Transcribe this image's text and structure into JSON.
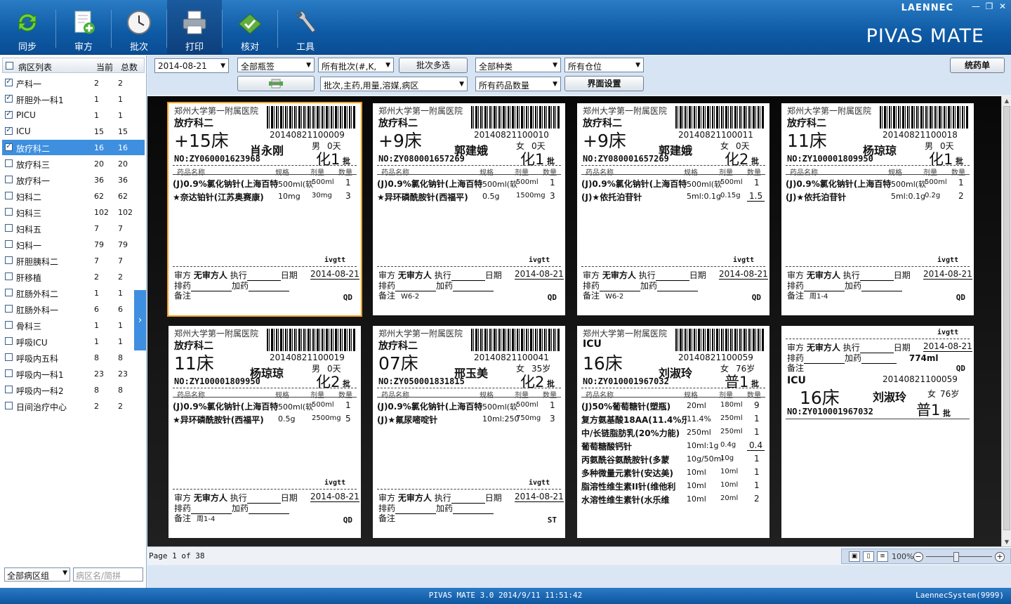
{
  "app": {
    "brand_top": "LAENNEC",
    "brand_big": "PIVAS MATE",
    "win_min": "—",
    "win_restore": "❐",
    "win_close": "✕"
  },
  "toolbar": [
    {
      "key": "sync",
      "label": "同步",
      "icon": "sync-icon"
    },
    {
      "key": "review",
      "label": "审方",
      "icon": "prescription-review-icon"
    },
    {
      "key": "batch",
      "label": "批次",
      "icon": "clock-icon"
    },
    {
      "key": "print",
      "label": "打印",
      "icon": "printer-icon"
    },
    {
      "key": "check",
      "label": "核对",
      "icon": "verify-icon"
    },
    {
      "key": "tools",
      "label": "工具",
      "icon": "wrench-icon"
    }
  ],
  "sidebar": {
    "header": {
      "name": "病区列表",
      "current": "当前",
      "total": "总数"
    },
    "wards": [
      {
        "name": "产科一",
        "current": "2",
        "total": "2",
        "checked": true
      },
      {
        "name": "肝胆外一科1",
        "current": "1",
        "total": "1",
        "checked": true
      },
      {
        "name": "PICU",
        "current": "1",
        "total": "1",
        "checked": true
      },
      {
        "name": "ICU",
        "current": "15",
        "total": "15",
        "checked": true
      },
      {
        "name": "放疗科二",
        "current": "16",
        "total": "16",
        "checked": true,
        "selected": true
      },
      {
        "name": "放疗科三",
        "current": "20",
        "total": "20",
        "checked": false
      },
      {
        "name": "放疗科一",
        "current": "36",
        "total": "36",
        "checked": false
      },
      {
        "name": "妇科二",
        "current": "62",
        "total": "62",
        "checked": false
      },
      {
        "name": "妇科三",
        "current": "102",
        "total": "102",
        "checked": false
      },
      {
        "name": "妇科五",
        "current": "7",
        "total": "7",
        "checked": false
      },
      {
        "name": "妇科一",
        "current": "79",
        "total": "79",
        "checked": false
      },
      {
        "name": "肝胆胰科二",
        "current": "7",
        "total": "7",
        "checked": false
      },
      {
        "name": "肝移植",
        "current": "2",
        "total": "2",
        "checked": false
      },
      {
        "name": "肛肠外科二",
        "current": "1",
        "total": "1",
        "checked": false
      },
      {
        "name": "肛肠外科一",
        "current": "6",
        "total": "6",
        "checked": false
      },
      {
        "name": "骨科三",
        "current": "1",
        "total": "1",
        "checked": false
      },
      {
        "name": "呼吸ICU",
        "current": "1",
        "total": "1",
        "checked": false
      },
      {
        "name": "呼吸内五科",
        "current": "8",
        "total": "8",
        "checked": false
      },
      {
        "name": "呼吸内一科1",
        "current": "23",
        "total": "23",
        "checked": false
      },
      {
        "name": "呼吸内一科2",
        "current": "8",
        "total": "8",
        "checked": false
      },
      {
        "name": "日间治疗中心",
        "current": "2",
        "total": "2",
        "checked": false
      }
    ],
    "ward_group": "全部病区组",
    "search_placeholder": "病区名/简拼"
  },
  "filters": {
    "date": "2014-08-21",
    "label_type": "全部瓶签",
    "batch": "所有批次(#,K,",
    "batch_multi": "批次多选",
    "category": "全部种类",
    "position": "所有仓位",
    "sort": "批次,主药,用量,溶媒,病区",
    "quantity": "所有药品数量",
    "ui_settings": "界面设置",
    "summary": "统药单"
  },
  "labels": [
    {
      "hospital": "郑州大学第一附属医院",
      "ward": "放疗科二",
      "bed": "+15床",
      "batch_no": "20140821100009",
      "patient": "肖永刚",
      "sex": "男",
      "age": "0天",
      "no": "NO:ZY060001623968",
      "type": "化1",
      "pi": "批",
      "drugs": [
        {
          "name": "(J)0.9%氯化钠针(上海百特)",
          "spec": "500ml(软",
          "dose": "500ml",
          "qty": "1"
        },
        {
          "name": "★奈达铂针(江苏奥赛康)",
          "spec": "10mg",
          "dose": "30mg",
          "qty": "3"
        }
      ],
      "route": "ivgtt",
      "reviewer": "无审方人",
      "date": "2014-08-21",
      "remark": "",
      "freq": "QD",
      "active": true
    },
    {
      "hospital": "郑州大学第一附属医院",
      "ward": "放疗科二",
      "bed": "+9床",
      "batch_no": "20140821100010",
      "patient": "郭建娥",
      "sex": "女",
      "age": "0天",
      "no": "NO:ZY080001657269",
      "type": "化1",
      "pi": "批",
      "drugs": [
        {
          "name": "(J)0.9%氯化钠针(上海百特)",
          "spec": "500ml(软",
          "dose": "500ml",
          "qty": "1"
        },
        {
          "name": "★异环磷酰胺针(西福平)",
          "spec": "0.5g",
          "dose": "1500mg",
          "qty": "3"
        }
      ],
      "route": "ivgtt",
      "reviewer": "无审方人",
      "date": "2014-08-21",
      "remark": "W6-2",
      "freq": "QD"
    },
    {
      "hospital": "郑州大学第一附属医院",
      "ward": "放疗科二",
      "bed": "+9床",
      "batch_no": "20140821100011",
      "patient": "郭建娥",
      "sex": "女",
      "age": "0天",
      "no": "NO:ZY080001657269",
      "type": "化2",
      "pi": "批",
      "drugs": [
        {
          "name": "(J)0.9%氯化钠针(上海百特)",
          "spec": "500ml(软",
          "dose": "500ml",
          "qty": "1"
        },
        {
          "name": "(J)★依托泊苷针",
          "spec": "5ml:0.1g",
          "dose": "0.15g",
          "qty": "1.5",
          "ul": true
        }
      ],
      "route": "ivgtt",
      "reviewer": "无审方人",
      "date": "2014-08-21",
      "remark": "W6-2",
      "freq": "QD"
    },
    {
      "hospital": "郑州大学第一附属医院",
      "ward": "放疗科二",
      "bed": "11床",
      "batch_no": "20140821100018",
      "patient": "杨琼琼",
      "sex": "男",
      "age": "0天",
      "no": "NO:ZY100001809950",
      "type": "化1",
      "pi": "批",
      "drugs": [
        {
          "name": "(J)0.9%氯化钠针(上海百特)",
          "spec": "500ml(软",
          "dose": "500ml",
          "qty": "1"
        },
        {
          "name": "(J)★依托泊苷针",
          "spec": "5ml:0.1g",
          "dose": "0.2g",
          "qty": "2"
        }
      ],
      "route": "ivgtt",
      "reviewer": "无审方人",
      "date": "2014-08-21",
      "remark": "周1-4",
      "freq": "QD"
    },
    {
      "hospital": "郑州大学第一附属医院",
      "ward": "放疗科二",
      "bed": "11床",
      "batch_no": "20140821100019",
      "patient": "杨琼琼",
      "sex": "男",
      "age": "0天",
      "no": "NO:ZY100001809950",
      "type": "化2",
      "pi": "批",
      "drugs": [
        {
          "name": "(J)0.9%氯化钠针(上海百特)",
          "spec": "500ml(软",
          "dose": "500ml",
          "qty": "1"
        },
        {
          "name": "★异环磷酰胺针(西福平)",
          "spec": "0.5g",
          "dose": "2500mg",
          "qty": "5"
        }
      ],
      "route": "ivgtt",
      "reviewer": "无审方人",
      "date": "2014-08-21",
      "remark": "周1-4",
      "freq": "QD"
    },
    {
      "hospital": "郑州大学第一附属医院",
      "ward": "放疗科二",
      "bed": "07床",
      "batch_no": "20140821100041",
      "patient": "邢玉美",
      "sex": "女",
      "age": "35岁",
      "no": "NO:ZY050001831815",
      "type": "化2",
      "pi": "批",
      "drugs": [
        {
          "name": "(J)0.9%氯化钠针(上海百特)",
          "spec": "500ml(软",
          "dose": "500ml",
          "qty": "1"
        },
        {
          "name": "(J)★氟尿嘧啶针",
          "spec": "10ml:250",
          "dose": "750mg",
          "qty": "3"
        }
      ],
      "route": "ivgtt",
      "reviewer": "无审方人",
      "date": "2014-08-21",
      "remark": "",
      "freq": "ST"
    },
    {
      "hospital": "郑州大学第一附属医院",
      "ward": "ICU",
      "bed": "16床",
      "batch_no": "20140821100059",
      "patient": "刘淑玲",
      "sex": "女",
      "age": "76岁",
      "no": "NO:ZY010001967032",
      "type": "普1",
      "pi": "批",
      "drugs": [
        {
          "name": "(J)50%葡萄糖针(塑瓶)",
          "spec": "20ml",
          "dose": "180ml",
          "qty": "9"
        },
        {
          "name": "复方氨基酸18AA(11.4%乐",
          "spec": "11.4%",
          "dose": "250ml",
          "qty": "1"
        },
        {
          "name": "中/长链脂肪乳(20%力能)",
          "spec": "250ml",
          "dose": "250ml",
          "qty": "1"
        },
        {
          "name": "葡萄糖酸钙针",
          "spec": "10ml:1g",
          "dose": "0.4g",
          "qty": "0.4",
          "ul": true
        },
        {
          "name": "丙氨酰谷氨酰胺针(多蒙",
          "spec": "10g/50ml",
          "dose": "10g",
          "qty": "1"
        },
        {
          "name": "多种微量元素针(安达美)",
          "spec": "10ml",
          "dose": "10ml",
          "qty": "1"
        },
        {
          "name": "脂溶性维生素II针(维他利",
          "spec": "10ml",
          "dose": "10ml",
          "qty": "1"
        },
        {
          "name": "水溶性维生素针(水乐维",
          "spec": "10ml",
          "dose": "20ml",
          "qty": "2"
        }
      ],
      "continued": true
    },
    {
      "cont": true,
      "route": "ivgtt",
      "batch_no": "20140821100059",
      "reviewer": "无审方人",
      "date": "2014-08-21",
      "total": "774ml",
      "freq": "QD",
      "ward": "ICU",
      "bed": "16床",
      "patient": "刘淑玲",
      "sex": "女",
      "age": "76岁",
      "no": "NO:ZY010001967032",
      "type": "普1",
      "pi": "批"
    }
  ],
  "footer_labels": {
    "reviewer_lbl": "审方",
    "exec_lbl": "执行",
    "date_lbl": "日期",
    "pai_lbl": "排药",
    "add_lbl": "加药",
    "remark_lbl": "备注"
  },
  "col_heads": {
    "name": "药品名称",
    "spec": "规格",
    "dose": "剂量",
    "qty": "数量"
  },
  "pager": {
    "text": "Page 1 of 38",
    "zoom": "100%"
  },
  "status": {
    "center": "PIVAS MATE 3.0 2014/9/11 11:51:42",
    "right": "LaennecSystem(9999)"
  }
}
